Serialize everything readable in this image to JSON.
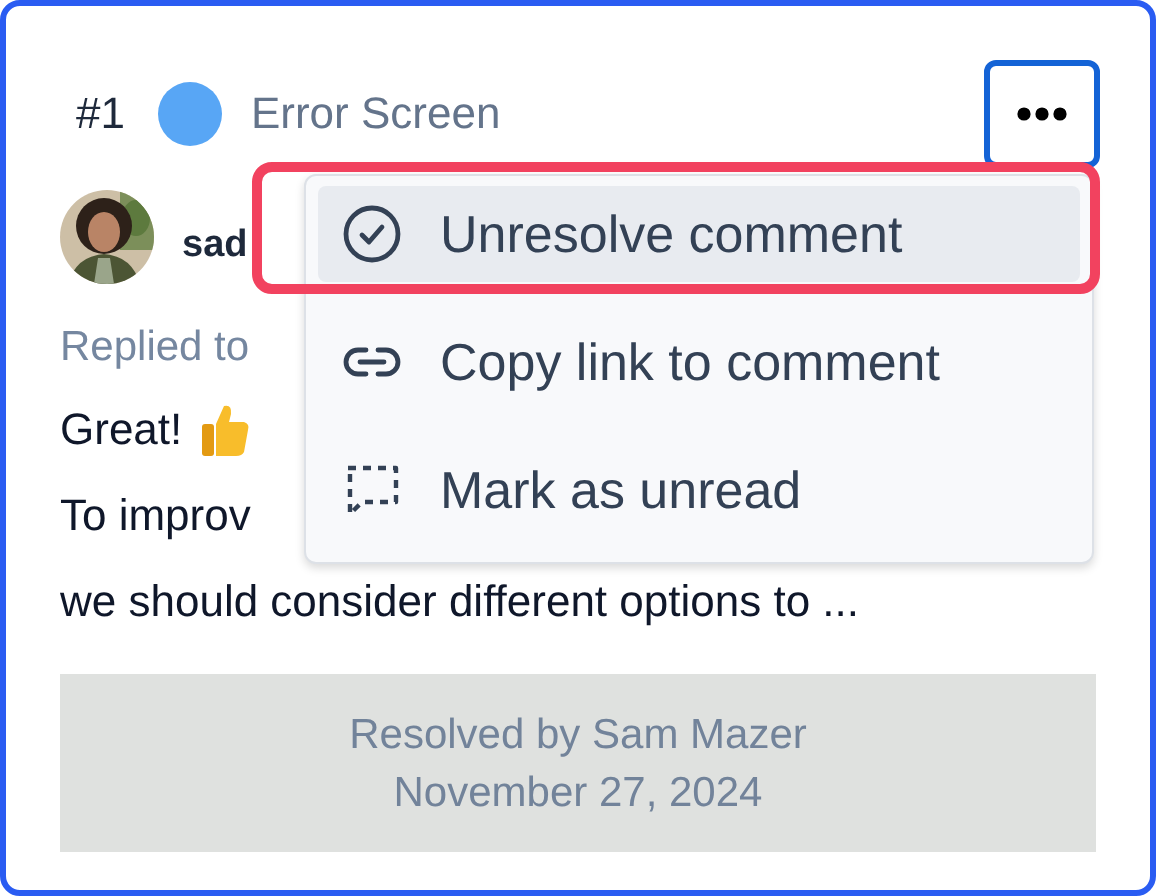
{
  "thread": {
    "number": "#1",
    "title": "Error Screen"
  },
  "comment": {
    "author": "sad",
    "reply_line": "Replied to",
    "lines": [
      "Great!",
      "To improv",
      "we should consider different options to ..."
    ]
  },
  "menu": {
    "items": [
      {
        "kind": "check",
        "label": "Unresolve comment",
        "selected": true
      },
      {
        "kind": "link",
        "label": "Copy link to comment",
        "selected": false
      },
      {
        "kind": "unread",
        "label": "Mark as unread",
        "selected": false
      }
    ]
  },
  "resolved": {
    "by": "Resolved by Sam Mazer",
    "date": "November 27, 2024"
  }
}
